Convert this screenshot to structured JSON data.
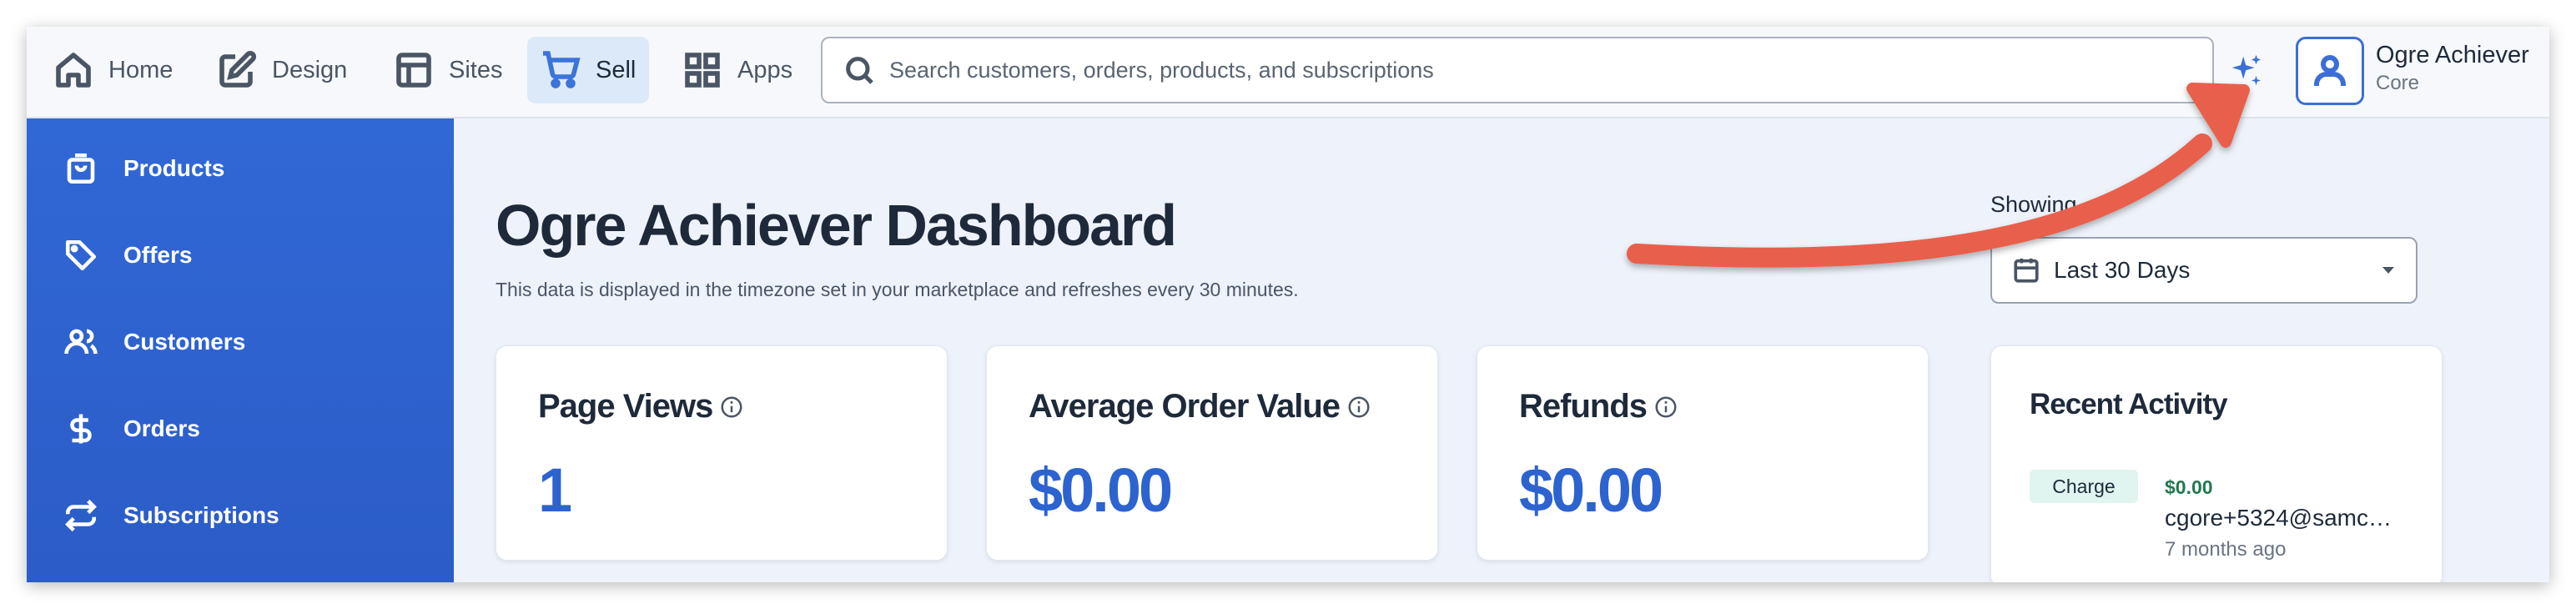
{
  "nav": {
    "items": [
      {
        "label": "Home",
        "icon": "home-icon"
      },
      {
        "label": "Design",
        "icon": "edit-icon"
      },
      {
        "label": "Sites",
        "icon": "layout-icon"
      },
      {
        "label": "Sell",
        "icon": "cart-icon",
        "active": true
      },
      {
        "label": "Apps",
        "icon": "grid-icon"
      }
    ]
  },
  "search": {
    "placeholder": "Search customers, orders, products, and subscriptions",
    "value": ""
  },
  "user": {
    "name": "Ogre Achiever",
    "plan": "Core"
  },
  "sidebar": {
    "items": [
      {
        "label": "Products",
        "icon": "bag-icon"
      },
      {
        "label": "Offers",
        "icon": "tag-icon"
      },
      {
        "label": "Customers",
        "icon": "users-icon"
      },
      {
        "label": "Orders",
        "icon": "dollar-icon"
      },
      {
        "label": "Subscriptions",
        "icon": "repeat-icon"
      }
    ]
  },
  "dashboard": {
    "title": "Ogre Achiever Dashboard",
    "subtitle": "This data is displayed in the timezone set in your marketplace and refreshes every 30 minutes.",
    "showing_label": "Showing",
    "date_range": "Last 30 Days"
  },
  "cards": [
    {
      "title": "Page Views",
      "value": "1"
    },
    {
      "title": "Average Order Value",
      "value": "$0.00"
    },
    {
      "title": "Refunds",
      "value": "$0.00"
    }
  ],
  "activity": {
    "title": "Recent Activity",
    "items": [
      {
        "badge": "Charge",
        "amount": "$0.00",
        "email": "cgore+5324@samc…",
        "time": "7 months ago"
      }
    ]
  },
  "colors": {
    "accent": "#2d63cf",
    "sidebar": "#3068d6",
    "annotation_arrow": "#e8604c",
    "positive": "#1f7a4d"
  }
}
